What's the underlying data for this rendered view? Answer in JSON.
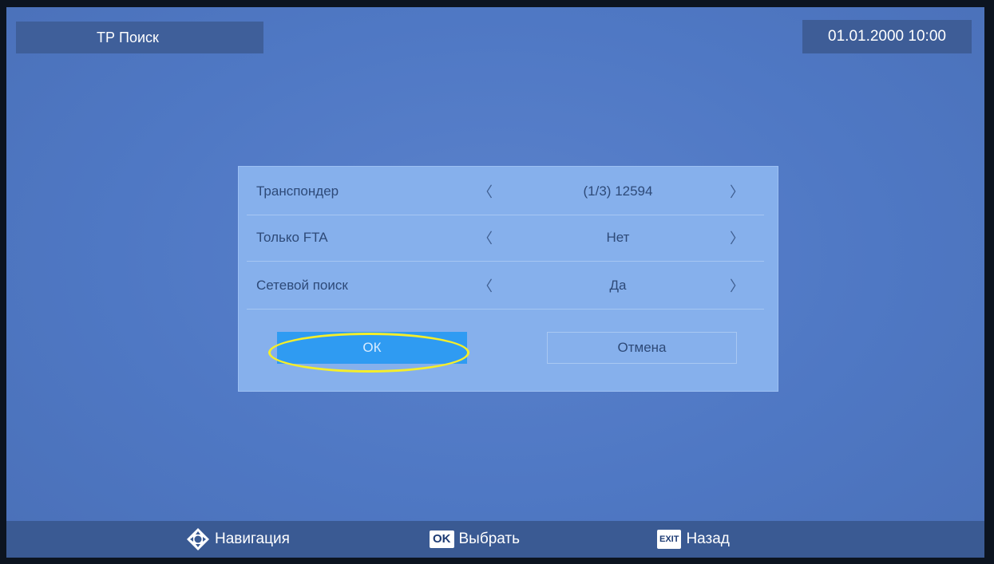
{
  "header": {
    "title": "ТР Поиск",
    "datetime": "01.01.2000 10:00"
  },
  "dialog": {
    "rows": [
      {
        "label": "Транспондер",
        "left_arrow": "〈",
        "value": "(1/3) 12594",
        "right_arrow": "〉"
      },
      {
        "label": "Только FTA",
        "left_arrow": "〈",
        "value": "Нет",
        "right_arrow": "〉"
      },
      {
        "label": "Сетевой поиск",
        "left_arrow": "〈",
        "value": "Да",
        "right_arrow": "〉"
      }
    ],
    "ok_label": "ОК",
    "cancel_label": "Отмена"
  },
  "footer": {
    "nav_label": "Навигация",
    "ok_key": "OK",
    "ok_label": "Выбрать",
    "exit_key": "EXIT",
    "exit_label": "Назад"
  },
  "colors": {
    "background": "#5078c4",
    "dialog": "#86b0ec",
    "selected_button": "#2f9bf2",
    "highlight": "#f5ee2a"
  }
}
